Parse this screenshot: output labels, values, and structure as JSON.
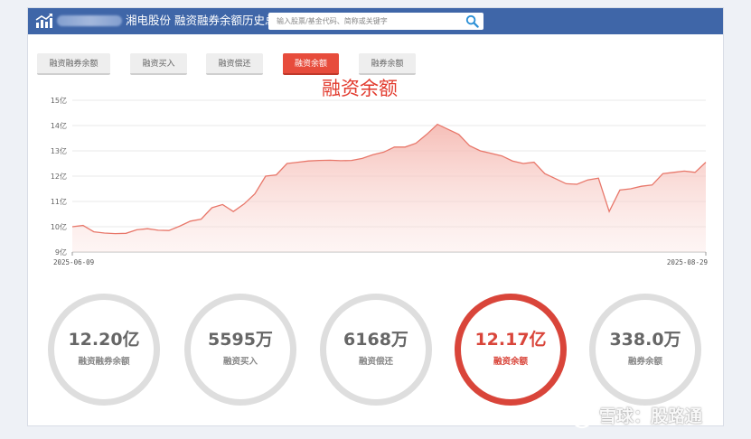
{
  "header": {
    "title": "湘电股份  融资融券余额历史总览",
    "search_placeholder": "输入股票/基金代码、简称或关键字"
  },
  "tabs": [
    {
      "label": "融资融券余额",
      "active": false
    },
    {
      "label": "融资买入",
      "active": false
    },
    {
      "label": "融资偿还",
      "active": false
    },
    {
      "label": "融资余额",
      "active": true
    },
    {
      "label": "融券余额",
      "active": false
    }
  ],
  "chart_title": "融资余额",
  "chart_data": {
    "type": "area",
    "title": "融资余额",
    "y_ticks": [
      "9亿",
      "10亿",
      "11亿",
      "12亿",
      "13亿",
      "14亿",
      "15亿"
    ],
    "ylim": [
      9,
      15
    ],
    "x_start_label": "2025-06-09",
    "x_end_label": "2025-08-29",
    "values": [
      10.0,
      10.05,
      9.8,
      9.75,
      9.73,
      9.74,
      9.88,
      9.92,
      9.86,
      9.85,
      10.02,
      10.22,
      10.3,
      10.75,
      10.88,
      10.6,
      10.9,
      11.3,
      12.0,
      12.05,
      12.5,
      12.55,
      12.6,
      12.62,
      12.63,
      12.61,
      12.62,
      12.7,
      12.85,
      12.95,
      13.15,
      13.15,
      13.3,
      13.65,
      14.05,
      13.85,
      13.65,
      13.2,
      13.0,
      12.9,
      12.8,
      12.6,
      12.5,
      12.55,
      12.1,
      11.9,
      11.7,
      11.68,
      11.85,
      11.92,
      10.6,
      11.45,
      11.5,
      11.6,
      11.65,
      12.1,
      12.15,
      12.2,
      12.15,
      12.55
    ],
    "line_color": "#e8776a",
    "fill_color": "#f7c9c4",
    "grid": true,
    "legend": "none"
  },
  "stats": [
    {
      "value": "12.20亿",
      "label": "融资融券余额",
      "active": false
    },
    {
      "value": "5595万",
      "label": "融资买入",
      "active": false
    },
    {
      "value": "6168万",
      "label": "融资偿还",
      "active": false
    },
    {
      "value": "12.17亿",
      "label": "融资余额",
      "active": true
    },
    {
      "value": "338.0万",
      "label": "融券余额",
      "active": false
    }
  ],
  "watermark": "雪球：股路通",
  "colors": {
    "header_bg": "#3f66a8",
    "accent": "#e74c3c",
    "active_ring": "#d9453a",
    "inactive_ring": "#dedede"
  }
}
